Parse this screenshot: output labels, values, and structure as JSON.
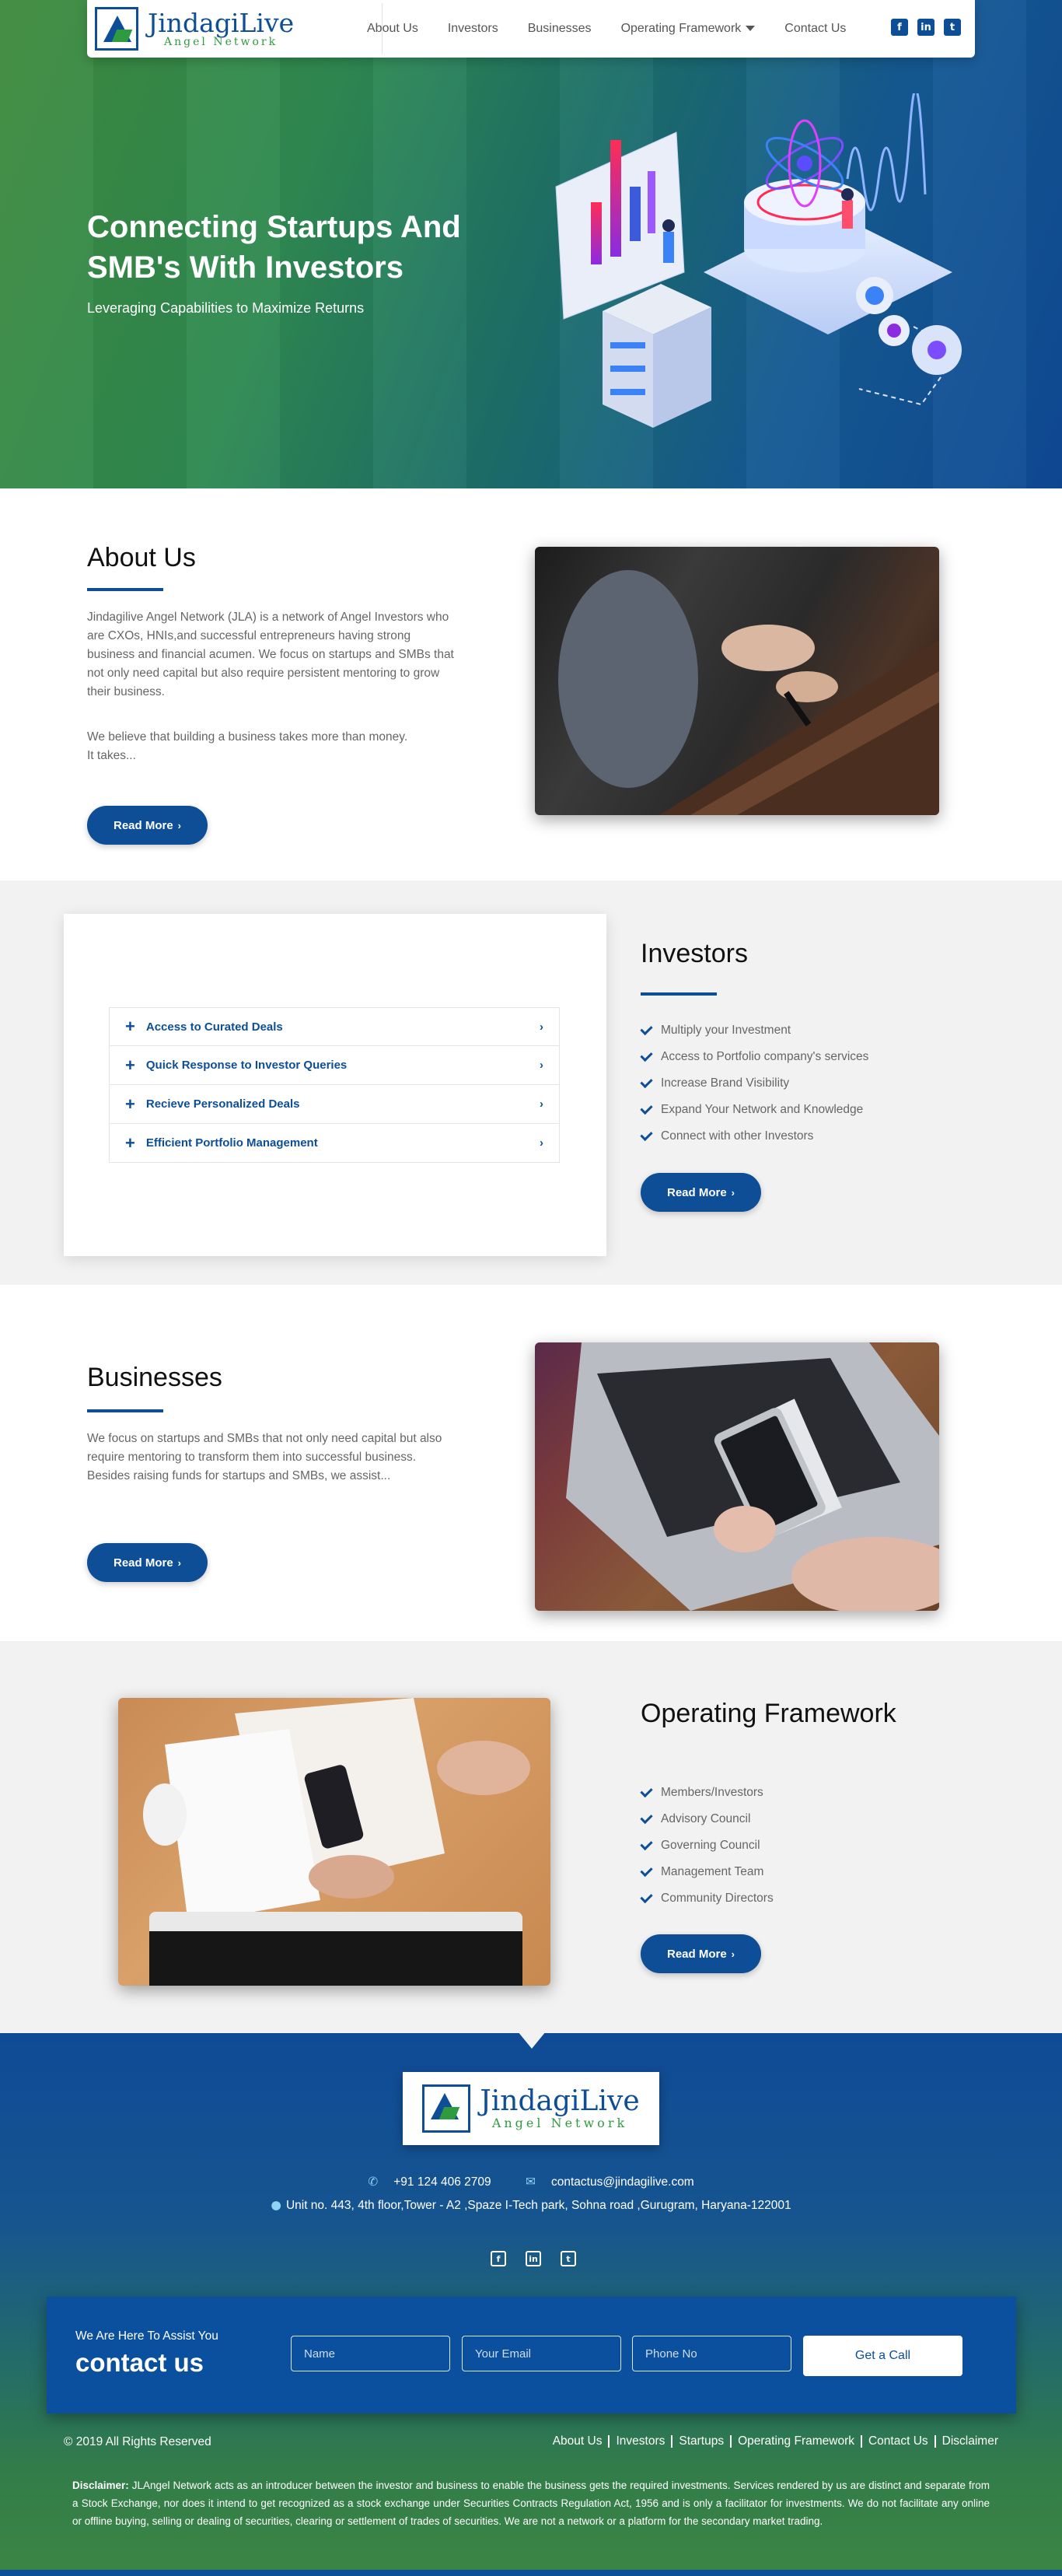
{
  "brand": {
    "name": "JindagiLive",
    "sub": "Angel Network"
  },
  "nav": {
    "items": [
      "About Us",
      "Investors",
      "Businesses",
      "Operating Framework",
      "Contact Us"
    ]
  },
  "social": {
    "icons": [
      "facebook-icon",
      "linkedin-icon",
      "twitter-icon"
    ]
  },
  "hero": {
    "title": "Connecting Startups And SMB's With Investors",
    "subtitle": "Leveraging Capabilities to Maximize Returns"
  },
  "about": {
    "title": "About Us",
    "p1": "Jindagilive Angel Network (JLA) is a network of Angel Investors who are CXOs, HNIs,and successful entrepreneurs having strong business and financial acumen. We focus on startups and SMBs that not only need capital but also require persistent mentoring to grow their business.",
    "p2": "We believe that building a business takes more than money. It takes...",
    "button": "Read More"
  },
  "investors": {
    "title": "Investors",
    "accordion": [
      "Access to Curated Deals",
      "Quick Response to Investor Queries",
      "Recieve Personalized Deals",
      "Efficient Portfolio Management"
    ],
    "items": [
      "Multiply your Investment",
      "Access to Portfolio company's services",
      "Increase Brand Visibility",
      "Expand Your Network and Knowledge",
      "Connect with other Investors"
    ],
    "button": "Read More"
  },
  "businesses": {
    "title": "Businesses",
    "p1": "We focus on startups and SMBs that not only need capital but also require mentoring to transform them into successful business. Besides raising funds for startups and SMBs, we assist...",
    "button": "Read More"
  },
  "framework": {
    "title": "Operating Framework",
    "items": [
      "Members/Investors",
      "Advisory Council",
      "Governing Council",
      "Management Team",
      "Community Directors"
    ],
    "button": "Read More"
  },
  "footer": {
    "phone": "+91 124 406 2709",
    "email": "contactus@jindagilive.com",
    "address": "Unit no. 443, 4th floor,Tower - A2 ,Spaze I-Tech park, Sohna road ,Gurugram, Haryana-122001",
    "copyright": "© 2019 All Rights Reserved",
    "links": [
      "About Us",
      "Investors",
      "Startups",
      "Operating Framework",
      "Contact Us",
      "Disclaimer"
    ],
    "disclaimer_label": "Disclaimer:",
    "disclaimer": " JLAngel Network acts as an introducer between the investor and business to enable the business gets the required investments. Services rendered by us are distinct and separate from a Stock Exchange, nor does it intend to get recognized as a stock exchange under Securities Contracts Regulation Act, 1956 and is only a facilitator for investments. We do not facilitate any online or offline buying, selling or dealing of securities, clearing or settlement of trades of securities. We are not a network or a platform for the secondary market trading."
  },
  "cta": {
    "small": "We Are Here To Assist You",
    "big": "contact us",
    "name_placeholder": "Name",
    "email_placeholder": "Your Email",
    "phone_placeholder": "Phone No",
    "button": "Get a Call"
  }
}
